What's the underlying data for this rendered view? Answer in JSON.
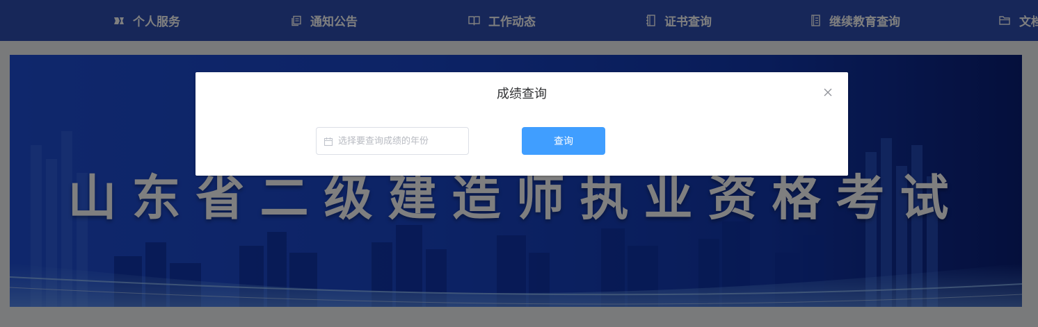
{
  "nav": {
    "items": [
      {
        "label": "个人服务",
        "icon": "ticket-icon"
      },
      {
        "label": "通知公告",
        "icon": "copy-icon"
      },
      {
        "label": "工作动态",
        "icon": "book-icon"
      },
      {
        "label": "证书查询",
        "icon": "notebook-icon"
      },
      {
        "label": "继续教育查询",
        "icon": "document-icon"
      },
      {
        "label": "文档",
        "icon": "folder-icon"
      }
    ]
  },
  "banner": {
    "title": "山东省二级建造师执业资格考试"
  },
  "dialog": {
    "title": "成绩查询",
    "year_input": {
      "value": "",
      "placeholder": "选择要查询成绩的年份"
    },
    "query_button": "查询"
  },
  "colors": {
    "nav_bg": "#2f4fb3",
    "primary_button": "#409eff",
    "banner_blue": "#1a47cc"
  }
}
